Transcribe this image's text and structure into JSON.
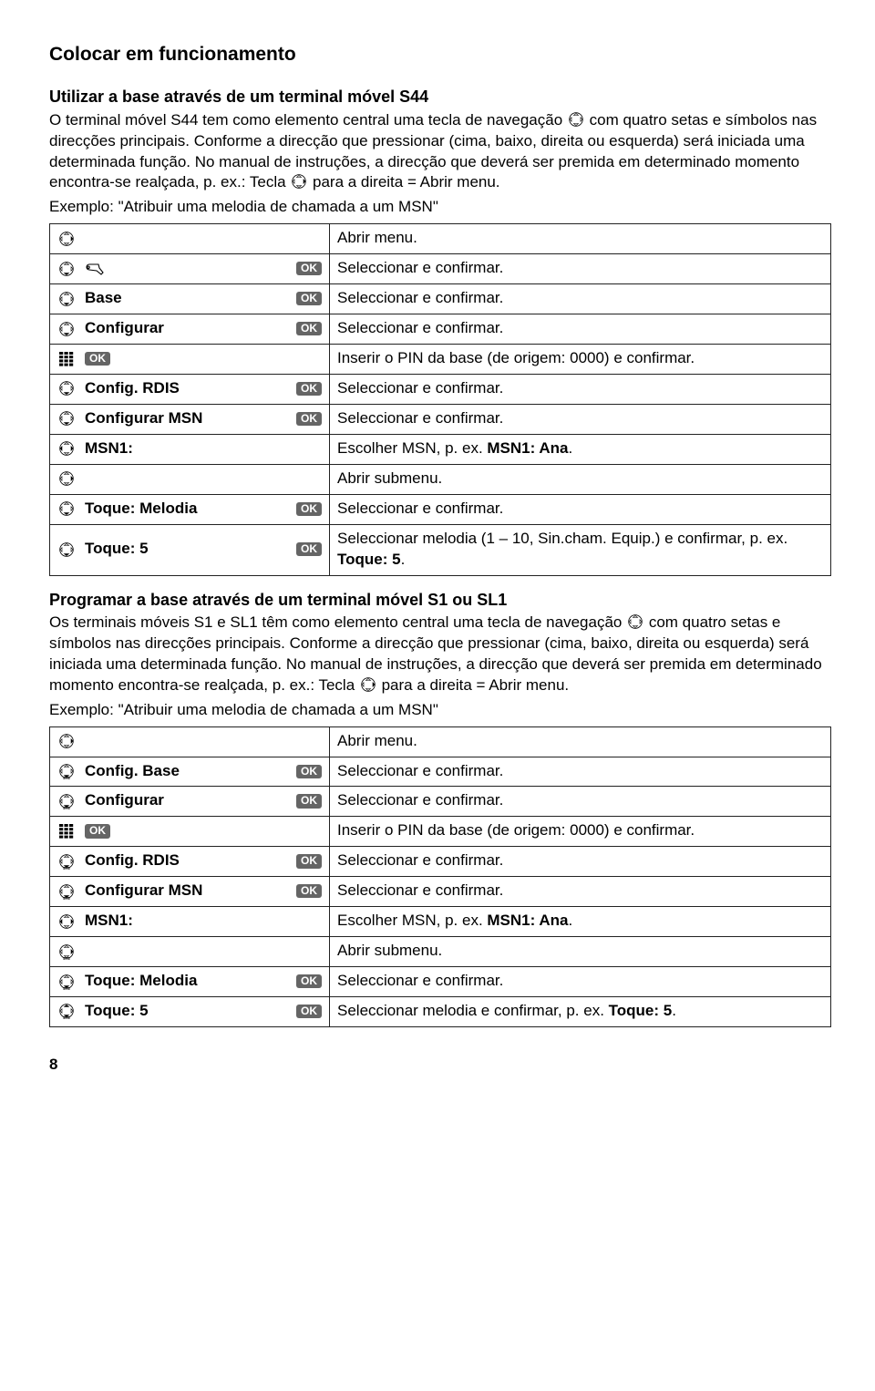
{
  "page_title": "Colocar em funcionamento",
  "section1": {
    "heading": "Utilizar a base através de um terminal móvel S44",
    "para1a": "O terminal móvel S44 tem como elemento central uma tecla de navegação ",
    "para1b": " com quatro setas e símbolos nas direcções principais. Conforme a direcção que pressionar (cima, baixo, direita ou esquerda) será iniciada uma determinada função. No manual de instruções, a direcção que deverá ser premida em determinado momento encontra-se realçada, p. ex.: Tecla ",
    "para1c": " para a direita = Abrir menu.",
    "example": "Exemplo: \"Atribuir uma melodia de chamada a um MSN\""
  },
  "ok_label": "OK",
  "table1": [
    {
      "label": "",
      "ok": false,
      "desc": "Abrir menu.",
      "icon": "right"
    },
    {
      "label": "",
      "ok": true,
      "desc": "Seleccionar e confirmar.",
      "icon": "down",
      "spanner": true
    },
    {
      "label": "Base",
      "ok": true,
      "desc": "Seleccionar e confirmar.",
      "icon": "down"
    },
    {
      "label": "Configurar",
      "ok": true,
      "desc": "Seleccionar e confirmar.",
      "icon": "down"
    },
    {
      "label": "",
      "ok": true,
      "desc": "Inserir o PIN da base (de origem: 0000) e confirmar.",
      "keypad": true,
      "ok_inline": true
    },
    {
      "label": "Config. RDIS",
      "ok": true,
      "desc": "Seleccionar e confirmar.",
      "icon": "down"
    },
    {
      "label": "Configurar MSN",
      "ok": true,
      "desc": "Seleccionar e confirmar.",
      "icon": "down"
    },
    {
      "label": "MSN1:",
      "ok": false,
      "desc_pre": "Escolher MSN, p. ex. ",
      "desc_bold": "MSN1: Ana",
      "desc_post": ".",
      "icon": "lr"
    },
    {
      "label": "",
      "ok": false,
      "desc": "Abrir submenu.",
      "icon": "right"
    },
    {
      "label": "Toque: Melodia",
      "ok": true,
      "desc": "Seleccionar e confirmar.",
      "icon": "down"
    },
    {
      "label": "Toque: 5",
      "ok": true,
      "desc_pre": "Seleccionar melodia (1 – 10, Sin.cham. Equip.) e confirmar, p. ex. ",
      "desc_bold": "Toque: 5",
      "desc_post": ".",
      "icon": "down"
    }
  ],
  "section2": {
    "heading": "Programar a base através de um terminal móvel S1 ou SL1",
    "para1a": "Os terminais móveis S1 e SL1 têm como elemento central uma tecla de navegação ",
    "para1b": " com quatro setas e símbolos nas direcções principais. Conforme a direcção que pressionar (cima, baixo, direita ou esquerda) será iniciada uma determinada função. No manual de instruções, a direcção que deverá ser premida em determinado momento encontra-se realçada, p. ex.: Tecla ",
    "para1c": " para a direita = Abrir menu.",
    "example": "Exemplo: \"Atribuir uma melodia de chamada a um MSN\""
  },
  "table2": [
    {
      "label": "",
      "ok": false,
      "desc": "Abrir menu.",
      "icon": "right"
    },
    {
      "label": "Config. Base",
      "ok": true,
      "desc": "Seleccionar e confirmar.",
      "icon": "down2"
    },
    {
      "label": "Configurar",
      "ok": true,
      "desc": "Seleccionar e confirmar.",
      "icon": "down2"
    },
    {
      "label": "",
      "ok": true,
      "desc": "Inserir o PIN da base (de origem: 0000) e confirmar.",
      "keypad": true,
      "ok_inline": true
    },
    {
      "label": "Config. RDIS",
      "ok": true,
      "desc": "Seleccionar e confirmar.",
      "icon": "down2"
    },
    {
      "label": "Configurar MSN",
      "ok": true,
      "desc": "Seleccionar e confirmar.",
      "icon": "down2"
    },
    {
      "label": "MSN1:",
      "ok": false,
      "desc_pre": "Escolher MSN, p. ex. ",
      "desc_bold": "MSN1: Ana",
      "desc_post": ".",
      "icon": "lr"
    },
    {
      "label": "",
      "ok": false,
      "desc": "Abrir submenu.",
      "icon": "right2"
    },
    {
      "label": "Toque: Melodia",
      "ok": true,
      "desc": "Seleccionar e confirmar.",
      "icon": "down2"
    },
    {
      "label": "Toque: 5",
      "ok": true,
      "desc_pre": "Seleccionar melodia e confirmar, p. ex. ",
      "desc_bold": "Toque: 5",
      "desc_post": ".",
      "icon": "ud"
    }
  ],
  "page_number": "8"
}
